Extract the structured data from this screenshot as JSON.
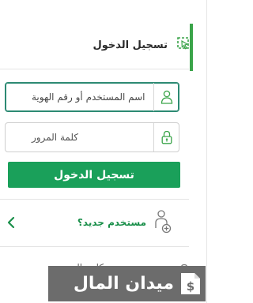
{
  "login": {
    "title": "تسجيل الدخول",
    "username_placeholder": "اسم المستخدم أو رقم الهوية",
    "password_placeholder": "كلمة المرور",
    "submit_label": "تسجيل الدخول"
  },
  "new_user": {
    "label": "مستخدم جديد؟"
  },
  "forgot": {
    "label": "نسيت كلمة المرور"
  },
  "watermark": {
    "text": "ميدان المال"
  },
  "colors": {
    "accent": "#3aa449",
    "button": "#1aa05a",
    "link": "#1a8f4a",
    "field_focus": "#2c8a73"
  }
}
